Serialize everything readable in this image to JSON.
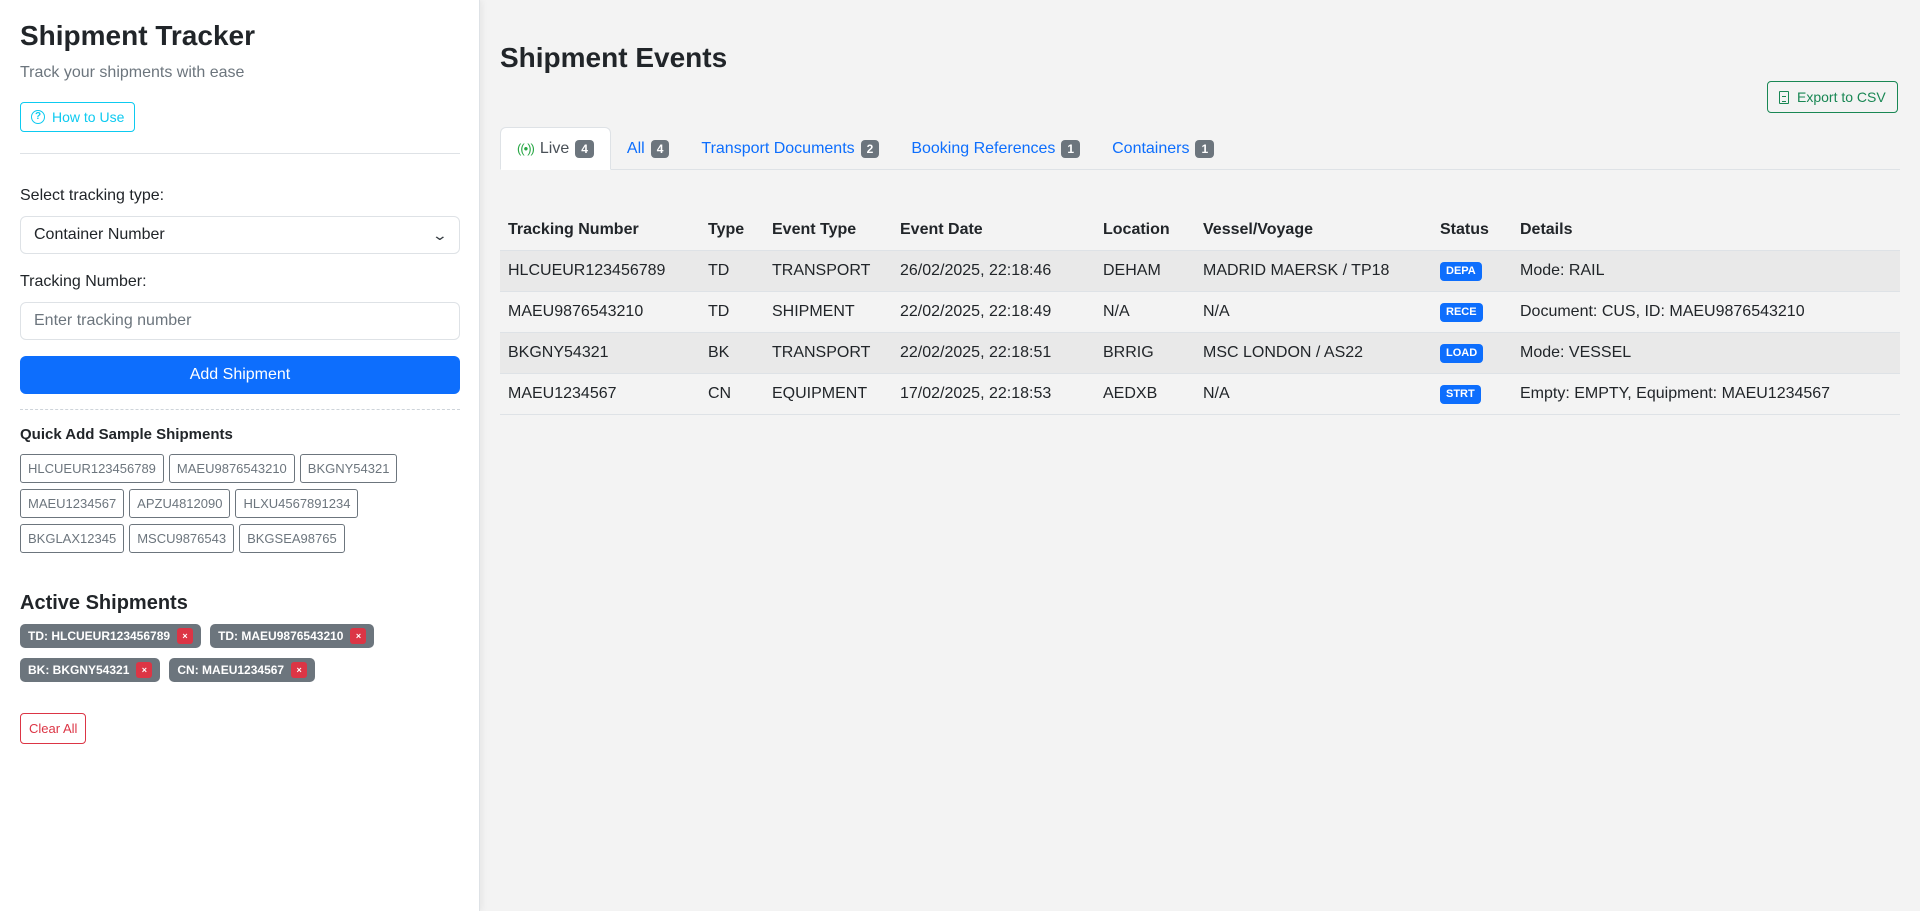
{
  "sidebar": {
    "title": "Shipment Tracker",
    "subtitle": "Track your shipments with ease",
    "how_to_use": "How to Use",
    "select_label": "Select tracking type:",
    "select_value": "Container Number",
    "tracking_label": "Tracking Number:",
    "tracking_placeholder": "Enter tracking number",
    "add_button": "Add Shipment",
    "quick_add_title": "Quick Add Sample Shipments",
    "samples": [
      "HLCUEUR123456789",
      "MAEU9876543210",
      "BKGNY54321",
      "MAEU1234567",
      "APZU4812090",
      "HLXU4567891234",
      "BKGLAX12345",
      "MSCU9876543",
      "BKGSEA98765"
    ],
    "active_title": "Active Shipments",
    "active": [
      "TD: HLCUEUR123456789",
      "TD: MAEU9876543210",
      "BK: BKGNY54321",
      "CN: MAEU1234567"
    ],
    "remove_symbol": "×",
    "clear_all": "Clear All"
  },
  "main": {
    "title": "Shipment Events",
    "export_button": "Export to CSV",
    "tabs": [
      {
        "label": "Live",
        "count": "4"
      },
      {
        "label": "All",
        "count": "4"
      },
      {
        "label": "Transport Documents",
        "count": "2"
      },
      {
        "label": "Booking References",
        "count": "1"
      },
      {
        "label": "Containers",
        "count": "1"
      }
    ],
    "columns": [
      "Tracking Number",
      "Type",
      "Event Type",
      "Event Date",
      "Location",
      "Vessel/Voyage",
      "Status",
      "Details"
    ],
    "rows": [
      [
        "HLCUEUR123456789",
        "TD",
        "TRANSPORT",
        "26/02/2025, 22:18:46",
        "DEHAM",
        "MADRID MAERSK / TP18",
        "DEPA",
        "Mode: RAIL"
      ],
      [
        "MAEU9876543210",
        "TD",
        "SHIPMENT",
        "22/02/2025, 22:18:49",
        "N/A",
        "N/A",
        "RECE",
        "Document: CUS, ID: MAEU9876543210"
      ],
      [
        "BKGNY54321",
        "BK",
        "TRANSPORT",
        "22/02/2025, 22:18:51",
        "BRRIG",
        "MSC LONDON / AS22",
        "LOAD",
        "Mode: VESSEL"
      ],
      [
        "MAEU1234567",
        "CN",
        "EQUIPMENT",
        "17/02/2025, 22:18:53",
        "AEDXB",
        "N/A",
        "STRT",
        "Empty: EMPTY, Equipment: MAEU1234567"
      ]
    ]
  },
  "colors": {
    "primary": "#0d6efd",
    "info": "#0dcaf0",
    "success": "#198754",
    "danger": "#dc3545",
    "secondary": "#6c757d"
  }
}
